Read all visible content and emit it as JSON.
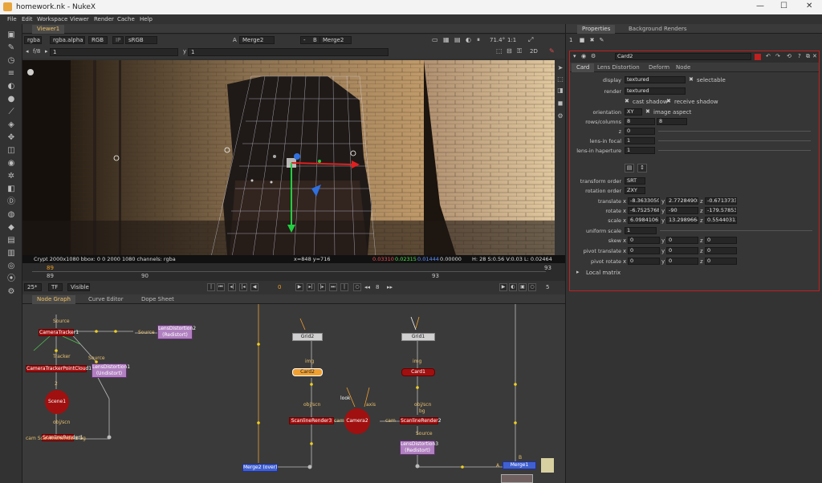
{
  "window": {
    "title": "homework.nk - NukeX",
    "min": "—",
    "max": "☐",
    "close": "✕"
  },
  "menu": [
    "File",
    "Edit",
    "Workspace",
    "Viewer",
    "Render",
    "Cache",
    "Help"
  ],
  "viewer": {
    "tab": "Viewer1",
    "channels": "rgba",
    "channel_alpha": "rgba.alpha",
    "colorspace_rgb": "RGB",
    "ip": "IP",
    "display": "sRGB",
    "a_label": "A",
    "a_input": "Merge2",
    "wipe": "-",
    "b_label": "B",
    "b_input": "Merge2",
    "zoom": "71.4°",
    "ratio": "1:1",
    "fstop": "f/8",
    "frame_field": "1",
    "y_label": "y",
    "y_field": "1",
    "mode_2d": "2D",
    "info_left": "Crypt 2000x1080  bbox: 0 0 2000 1080 channels: rgba",
    "info_coords": "x=848 y=716",
    "info_r": "0.03310",
    "info_g": "0.02315",
    "info_b": "0.01444",
    "info_a": "0.00000",
    "info_hsv": "H: 28 S:0.56 V:0.03  L: 0.02464"
  },
  "timeline": {
    "start": "89",
    "t1": "90",
    "t2": "93",
    "end": "93",
    "current": "89",
    "fps": "25*",
    "tf": "TF",
    "visible": "Visible",
    "frame": "0",
    "step": "8",
    "inc": "5"
  },
  "nodegraph": {
    "tabs": [
      "Node Graph",
      "Curve Editor",
      "Dope Sheet"
    ],
    "nodes": {
      "camera_tracker": "CameraTracker1",
      "lens_distortion2": "LensDistortion2\n(Redistort)",
      "point_cloud": "CameraTrackerPointCloud1",
      "lens_distortion1": "LensDistortion1\n(Undistort)",
      "scene": "Scene1",
      "scanline1": "ScanlineRender1",
      "grid2": "Grid2",
      "card2": "Card2",
      "scanline_render3": "ScanlineRender3",
      "camera2": "Camera2",
      "grid1": "Grid1",
      "card1": "Card1",
      "scanline_render2": "ScanlineRender2",
      "lens_distortion3": "LensDistortion3\n(Redistort)",
      "merge2": "Merge2 (over)",
      "merge_br": "Merge1"
    },
    "labels": {
      "source": "Source",
      "tracker": "Tracker",
      "source2": "Source",
      "num2": "2",
      "objscn": "obj/scn",
      "cam_bg": "cam ScanlineRender1 bg",
      "img": "img",
      "img2": "img",
      "objscn2": "obj/scn",
      "cam2": "cam",
      "look": "look",
      "axis": "axis",
      "objscn3": "obj/scn",
      "bg": "bg",
      "cam3": "cam",
      "source3": "Source",
      "a": "A",
      "b": "B"
    }
  },
  "properties": {
    "tabs": [
      "Properties",
      "Background Renders"
    ],
    "node_name": "Card2",
    "subtabs": [
      "Card",
      "Lens Distortion",
      "Deform",
      "Node"
    ],
    "display_label": "display",
    "display_value": "textured",
    "selectable": "selectable",
    "render_label": "render",
    "render_value": "textured",
    "cast_shadow": "cast shadow",
    "receive_shadow": "receive shadow",
    "orientation_label": "orientation",
    "orientation_value": "XY",
    "image_aspect": "image aspect",
    "rows_label": "rows/columns",
    "rows_value": "8",
    "cols_value": "8",
    "z_label": "z",
    "z_value": "0",
    "lens_focal_label": "lens-in focal",
    "lens_focal_value": "1",
    "lens_hap_label": "lens-in haperture",
    "lens_hap_value": "1",
    "transform_order_label": "transform order",
    "transform_order_value": "SRT",
    "rotation_order_label": "rotation order",
    "rotation_order_value": "ZXY",
    "translate_label": "translate",
    "translate": {
      "x": "-8.36330505",
      "y": "2.77284908",
      "z": "-0.67137331"
    },
    "rotate_label": "rotate",
    "rotate": {
      "x": "-6.75257682",
      "y": "-90",
      "z": "-179.578536"
    },
    "scale_label": "scale",
    "scale": {
      "x": "6.09841061",
      "y": "13.2989664",
      "z": "0.55440313"
    },
    "uniform_scale_label": "uniform scale",
    "uniform_scale_value": "1",
    "skew_label": "skew",
    "skew": {
      "x": "0",
      "y": "0",
      "z": "0"
    },
    "pivot_translate_label": "pivot translate",
    "pivot_translate": {
      "x": "0",
      "y": "0",
      "z": "0"
    },
    "pivot_rotate_label": "pivot rotate",
    "pivot_rotate": {
      "x": "0",
      "y": "0",
      "z": "0"
    },
    "local_matrix": "Local matrix",
    "axis_x": "x",
    "axis_y": "y",
    "axis_z": "z"
  },
  "colors": {
    "accent": "#f0c060",
    "red_node": "#a01010",
    "purple_node": "#b080c0",
    "bg": "#2b2b2b"
  }
}
